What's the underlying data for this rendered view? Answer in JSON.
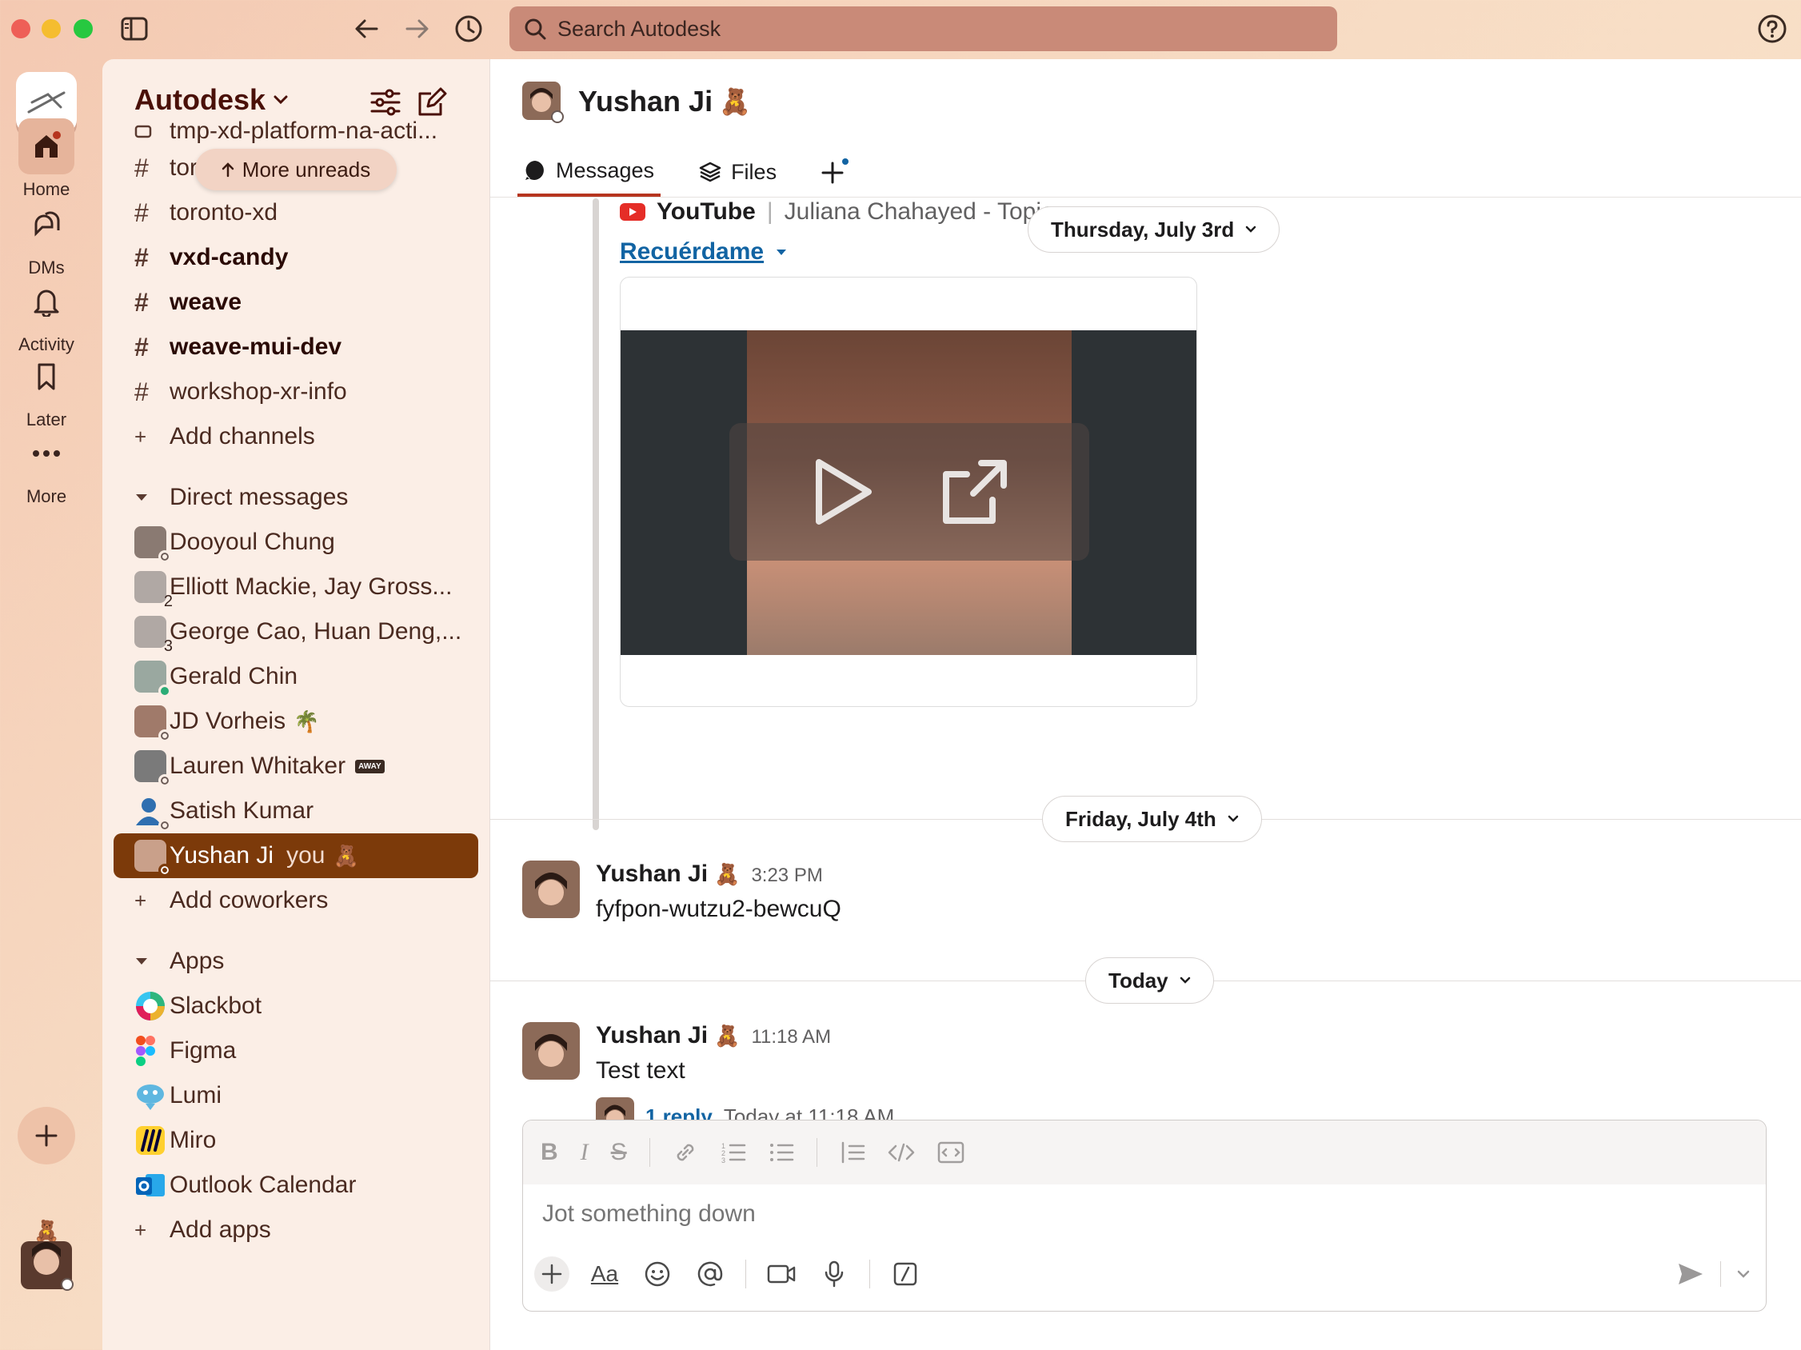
{
  "search": {
    "placeholder": "Search Autodesk"
  },
  "rail": {
    "items": [
      {
        "label": "Home"
      },
      {
        "label": "DMs"
      },
      {
        "label": "Activity"
      },
      {
        "label": "Later"
      },
      {
        "label": "More"
      }
    ]
  },
  "sidebar": {
    "workspace": "Autodesk",
    "more_unreads": "More unreads",
    "channels": [
      {
        "name": "tmp-xd-platform-na-acti...",
        "bold": false
      },
      {
        "name": "toronto",
        "bold": false
      },
      {
        "name": "toronto-xd",
        "bold": false
      },
      {
        "name": "vxd-candy",
        "bold": true
      },
      {
        "name": "weave",
        "bold": true
      },
      {
        "name": "weave-mui-dev",
        "bold": true
      },
      {
        "name": "workshop-xr-info",
        "bold": false
      }
    ],
    "add_channels": "Add channels",
    "dm_section": "Direct messages",
    "dms": [
      {
        "name": "Dooyoul Chung",
        "status": ""
      },
      {
        "name": "Elliott Mackie, Jay Gross...",
        "count": "2"
      },
      {
        "name": "George Cao, Huan Deng,...",
        "count": "3"
      },
      {
        "name": "Gerald Chin",
        "status": ""
      },
      {
        "name": "JD Vorheis",
        "emoji": "🌴"
      },
      {
        "name": "Lauren Whitaker",
        "emoji": "AWAY"
      },
      {
        "name": "Satish Kumar",
        "status": ""
      },
      {
        "name": "Yushan Ji",
        "suffix": "you",
        "emoji": "🧸"
      }
    ],
    "add_coworkers": "Add coworkers",
    "apps_section": "Apps",
    "apps": [
      {
        "name": "Slackbot"
      },
      {
        "name": "Figma"
      },
      {
        "name": "Lumi"
      },
      {
        "name": "Miro"
      },
      {
        "name": "Outlook Calendar"
      }
    ],
    "add_apps": "Add apps"
  },
  "channel": {
    "title": "Yushan Ji",
    "emoji": "🧸",
    "tabs": [
      {
        "label": "Messages"
      },
      {
        "label": "Files"
      }
    ]
  },
  "messages": {
    "youtube": {
      "source": "YouTube",
      "channel": "Juliana Chahayed - Topic",
      "title": "Recuérdame"
    },
    "dates": [
      {
        "label": "Thursday, July 3rd"
      },
      {
        "label": "Friday, July 4th"
      },
      {
        "label": "Today"
      }
    ],
    "items": [
      {
        "author": "Yushan Ji",
        "emoji": "🧸",
        "time": "3:23 PM",
        "text": "fyfpon-wutzu2-bewcuQ"
      },
      {
        "author": "Yushan Ji",
        "emoji": "🧸",
        "time": "11:18 AM",
        "text": "Test text",
        "reply_count": "1 reply",
        "reply_time": "Today at 11:18 AM"
      }
    ]
  },
  "composer": {
    "placeholder": "Jot something down",
    "format_label": "Aa"
  }
}
